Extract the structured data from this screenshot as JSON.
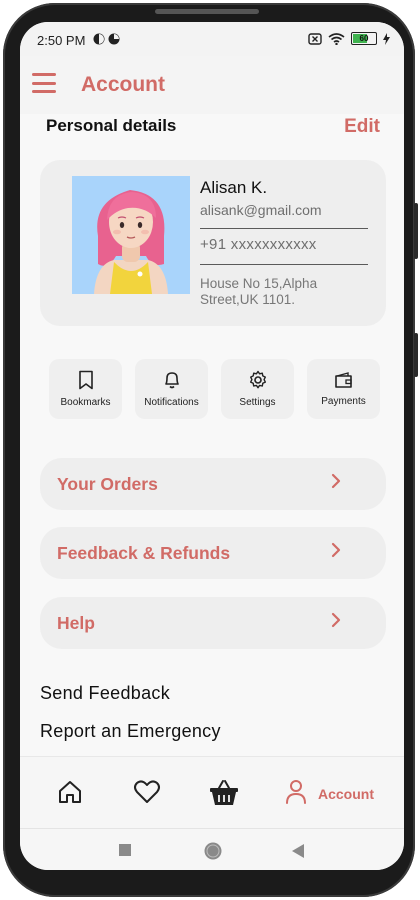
{
  "status_bar": {
    "time": "2:50 PM",
    "battery": "60",
    "icons": [
      "notification-dot-icon",
      "notification-dot-icon",
      "close-box-icon",
      "wifi-icon",
      "battery-icon",
      "charging-bolt-icon"
    ]
  },
  "header": {
    "title": "Account",
    "menu_icon": "hamburger-icon"
  },
  "personal_details": {
    "title": "Personal details",
    "edit_label": "Edit"
  },
  "profile": {
    "name": "Alisan K.",
    "email": "alisank@gmail.com",
    "phone": "+91 xxxxxxxxxxx",
    "address": "House No 15,Alpha Street,UK 1101."
  },
  "quick_actions": [
    {
      "label": "Bookmarks",
      "icon": "bookmark-icon"
    },
    {
      "label": "Notifications",
      "icon": "bell-icon"
    },
    {
      "label": "Settings",
      "icon": "gear-icon"
    },
    {
      "label": "Payments",
      "icon": "wallet-icon"
    }
  ],
  "menu_items": [
    {
      "label": "Your Orders"
    },
    {
      "label": "Feedback & Refunds"
    },
    {
      "label": "Help"
    }
  ],
  "links": {
    "send_feedback": "Send Feedback",
    "report_emergency": "Report an Emergency"
  },
  "bottom_nav": {
    "items": [
      {
        "icon": "home-icon"
      },
      {
        "icon": "heart-icon"
      },
      {
        "icon": "basket-icon"
      },
      {
        "icon": "user-icon",
        "label": "Account"
      }
    ],
    "active": "Account"
  },
  "system_nav": {
    "icons": [
      "recents-square-icon",
      "home-circle-icon",
      "back-triangle-icon"
    ]
  },
  "colors": {
    "accent": "#d16b66",
    "card_bg": "#eeeeee",
    "avatar_bg": "#a9d4fb"
  }
}
